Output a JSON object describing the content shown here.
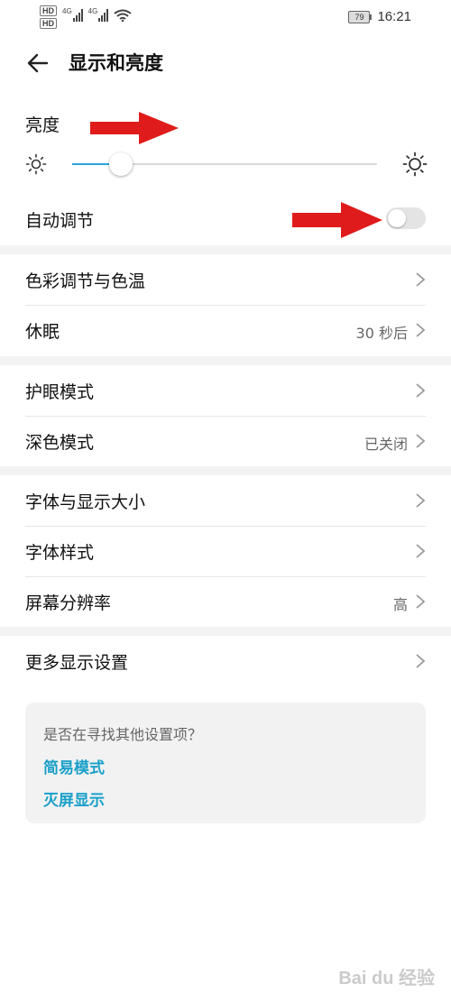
{
  "status_bar": {
    "hd1": "HD",
    "hd2": "HD",
    "net1": "4G",
    "net2": "4G",
    "battery": "79",
    "time": "16:21"
  },
  "header": {
    "title": "显示和亮度"
  },
  "brightness": {
    "label": "亮度",
    "level": 0.16
  },
  "auto_adjust": {
    "label": "自动调节",
    "on": false
  },
  "groups": [
    [
      {
        "label": "色彩调节与色温",
        "value": ""
      },
      {
        "label": "休眠",
        "value": "30 秒后"
      }
    ],
    [
      {
        "label": "护眼模式",
        "value": ""
      },
      {
        "label": "深色模式",
        "value": "已关闭"
      }
    ],
    [
      {
        "label": "字体与显示大小",
        "value": ""
      },
      {
        "label": "字体样式",
        "value": ""
      },
      {
        "label": "屏幕分辨率",
        "value": "高"
      }
    ],
    [
      {
        "label": "更多显示设置",
        "value": ""
      }
    ]
  ],
  "suggest": {
    "question": "是否在寻找其他设置项？",
    "links": [
      "简易模式",
      "灭屏显示"
    ]
  },
  "colors": {
    "accent": "#2aa8d8",
    "link": "#1aa0c9",
    "annotation_arrow": "#e01b1b"
  },
  "watermark": "Bai du 经验"
}
